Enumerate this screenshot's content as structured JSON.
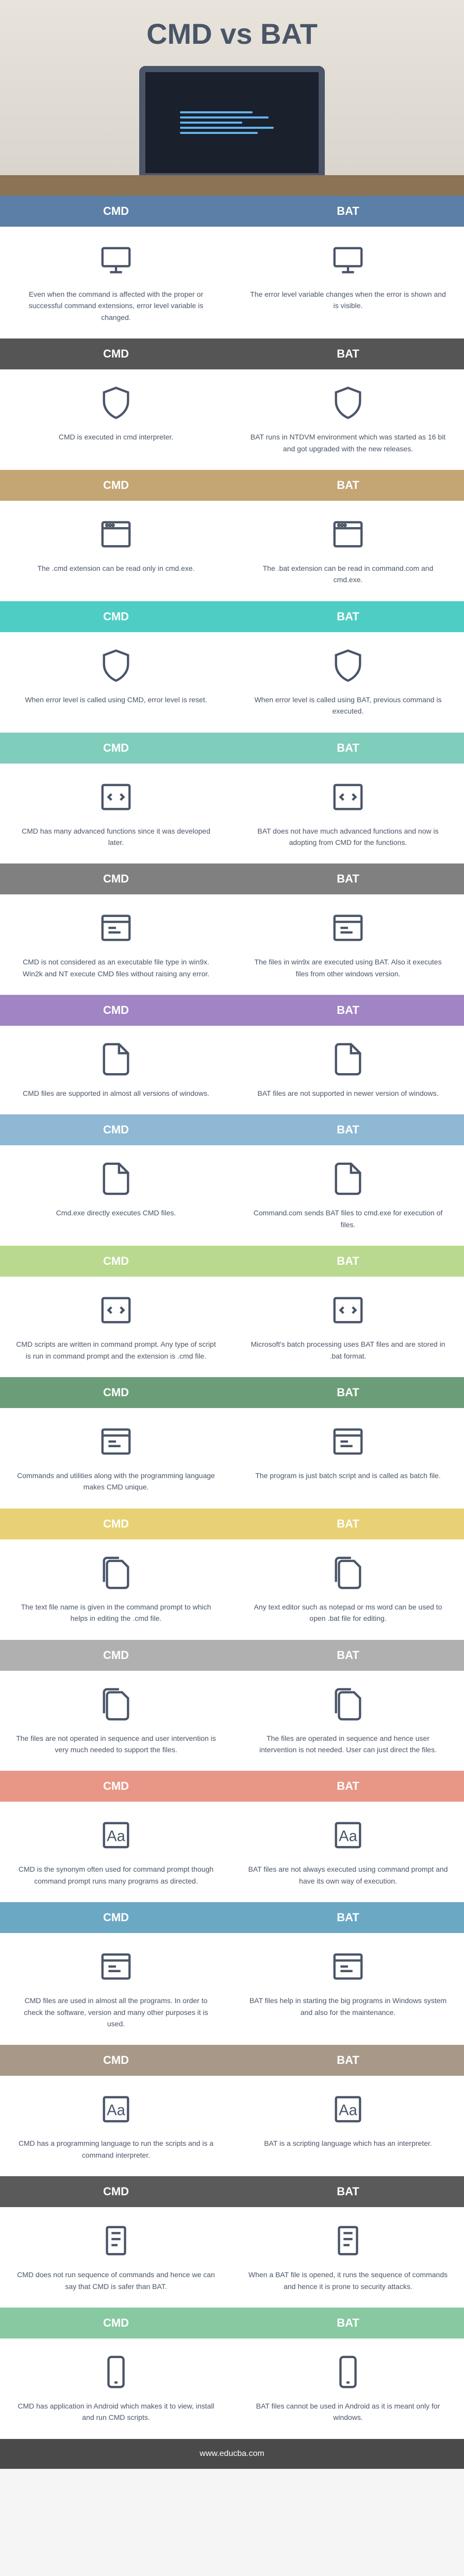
{
  "title": "CMD vs BAT",
  "footer": "www.educba.com",
  "labels": {
    "cmd": "CMD",
    "bat": "BAT"
  },
  "rows": [
    {
      "color": "c-blue",
      "cmd": "Even when the command is affected with the proper or successful command extensions, error level variable is changed.",
      "bat": "The error level variable changes when the error is shown and is visible.",
      "icon": "monitor"
    },
    {
      "color": "c-darkgray",
      "cmd": "CMD is executed in cmd interpreter.",
      "bat": "BAT runs in NTDVM environment which was started as 16 bit and got upgraded with the new releases.",
      "icon": "shield"
    },
    {
      "color": "c-tan",
      "cmd": "The .cmd extension can be read only in cmd.exe.",
      "bat": "The .bat extension can be read in command.com and cmd.exe.",
      "icon": "layout"
    },
    {
      "color": "c-teal",
      "cmd": "When error level is called using CMD, error level is reset.",
      "bat": "When error level is called using BAT, previous command is executed.",
      "icon": "shield"
    },
    {
      "color": "c-seafoam",
      "cmd": "CMD has many advanced functions since it was developed later.",
      "bat": "BAT does not have much advanced functions and now is adopting from CMD for the functions.",
      "icon": "code"
    },
    {
      "color": "c-gray",
      "cmd": "CMD is not considered as an executable file type in win9x. Win2k and NT execute CMD files without raising any error.",
      "bat": "The files in win9x are executed using BAT. Also it executes files from other windows version.",
      "icon": "window"
    },
    {
      "color": "c-purple",
      "cmd": "CMD files are supported in almost all versions of windows.",
      "bat": "BAT files are not supported in newer version of windows.",
      "icon": "file"
    },
    {
      "color": "c-lightblue",
      "cmd": "Cmd.exe directly executes CMD files.",
      "bat": "Command.com sends BAT files to cmd.exe for execution of files.",
      "icon": "file"
    },
    {
      "color": "c-lime",
      "cmd": "CMD scripts are written in command prompt. Any type of script is run in command prompt and the extension is .cmd file.",
      "bat": "Microsoft's batch processing uses BAT files and are stored in .bat format.",
      "icon": "code"
    },
    {
      "color": "c-green",
      "cmd": "Commands and utilities along with the programming language makes CMD unique.",
      "bat": "The program is just batch script and is called as batch file.",
      "icon": "window"
    },
    {
      "color": "c-yellow",
      "cmd": "The text file name is given in the command prompt to which helps in editing the .cmd file.",
      "bat": "Any text editor such as notepad or ms word can be used to open .bat file for editing.",
      "icon": "files"
    },
    {
      "color": "c-ltgray",
      "cmd": "The files are not operated in sequence and user intervention is very much needed to support the files.",
      "bat": "The files are operated in sequence and hence user intervention is not needed. User can just direct the files.",
      "icon": "files"
    },
    {
      "color": "c-coral",
      "cmd": "CMD is the synonym often used for command prompt though command prompt runs many programs as directed.",
      "bat": "BAT files are not always executed using command prompt and have its own way of execution.",
      "icon": "text"
    },
    {
      "color": "c-skyblue",
      "cmd": "CMD files are used in almost all the programs. In order to check the software, version and many other purposes it is used.",
      "bat": "BAT files help in starting the big programs in Windows system and also for the maintenance.",
      "icon": "window"
    },
    {
      "color": "c-taupe",
      "cmd": "CMD has a programming language to run the scripts and is a command interpreter.",
      "bat": "BAT is a scripting language which has an interpreter.",
      "icon": "text"
    },
    {
      "color": "c-darkgray2",
      "cmd": "CMD does not run sequence of commands and hence we can say that CMD is safer than BAT.",
      "bat": "When a BAT file is opened, it runs the sequence of commands and hence it is prone to security attacks.",
      "icon": "scroll"
    },
    {
      "color": "c-mint",
      "cmd": "CMD has application in Android which makes it to view, install and run CMD scripts.",
      "bat": "BAT files cannot be used in Android as it is meant only for windows.",
      "icon": "mobile"
    }
  ],
  "chart_data": {
    "type": "table",
    "title": "CMD vs BAT",
    "columns": [
      "CMD",
      "BAT"
    ],
    "rows_count": 17
  }
}
